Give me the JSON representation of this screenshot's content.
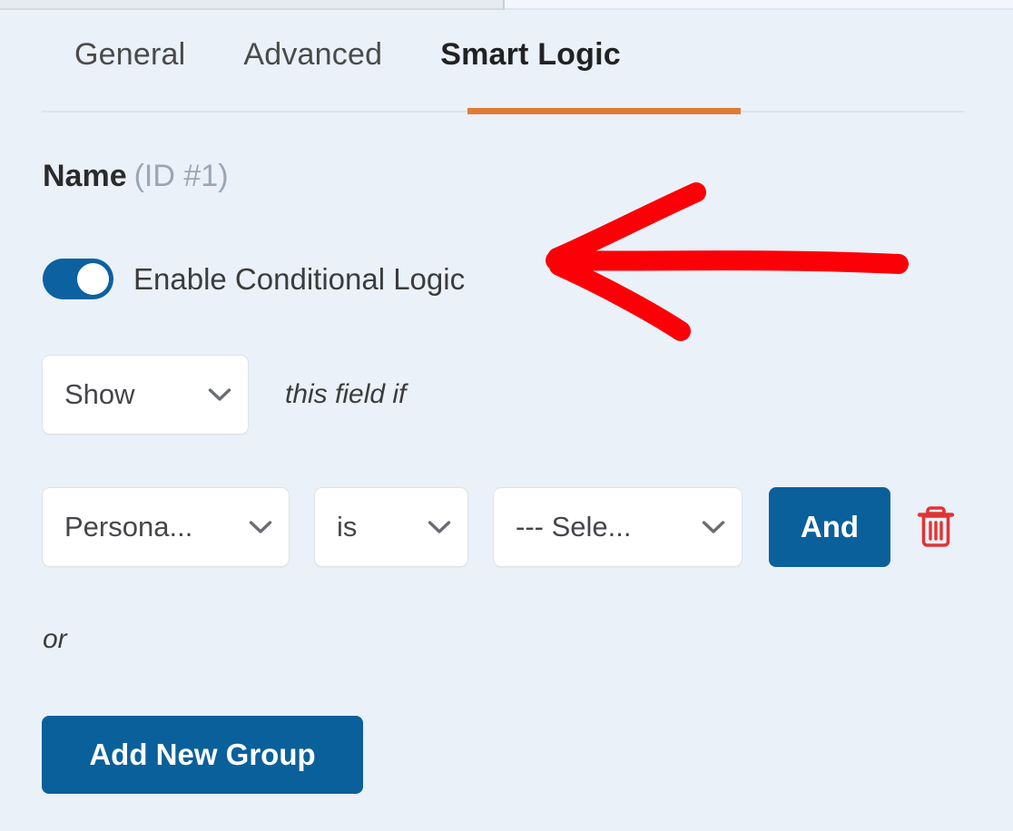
{
  "window": {
    "background_color": "#eaf1f9"
  },
  "tabs": {
    "items": [
      {
        "label": "General",
        "active": false
      },
      {
        "label": "Advanced",
        "active": false
      },
      {
        "label": "Smart Logic",
        "active": true
      }
    ],
    "active_accent_color": "#e07b33"
  },
  "field": {
    "name": "Name",
    "id_label": "(ID #1)"
  },
  "conditional_logic": {
    "toggle": {
      "label": "Enable Conditional Logic",
      "state": "on",
      "on_color": "#0c61a0"
    },
    "action_select": {
      "value": "Show",
      "icon": "chevron-down-icon"
    },
    "action_suffix_text": "this field if",
    "rule": {
      "field_select": {
        "value": "Persona...",
        "icon": "chevron-down-icon"
      },
      "operator_select": {
        "value": "is",
        "icon": "chevron-down-icon"
      },
      "value_select": {
        "value": "--- Sele...",
        "icon": "chevron-down-icon"
      },
      "and_button_label": "And",
      "delete_icon": "trash-icon",
      "delete_icon_color": "#e03434"
    },
    "group_separator_text": "or",
    "add_group_button_label": "Add New Group",
    "button_color": "#0a609b"
  },
  "annotation": {
    "type": "arrow",
    "direction": "left",
    "color": "#fb0007",
    "points_to": "Enable Conditional Logic toggle"
  }
}
